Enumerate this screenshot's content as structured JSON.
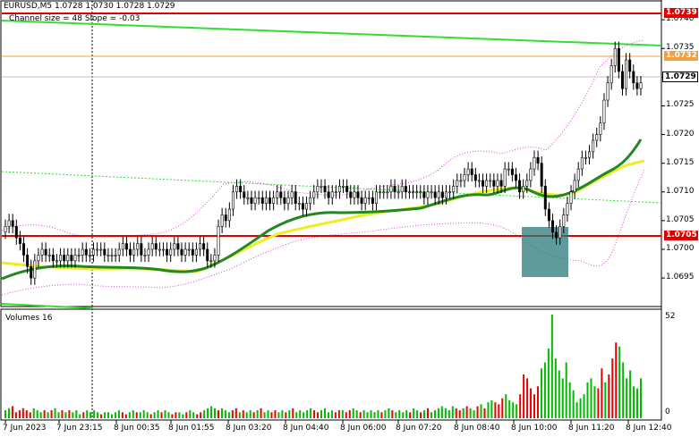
{
  "symbol_header": "EURUSD,M5  1.0728 1.0730 1.0728 1.0729",
  "indicator_label": "Channel size = 48 Slope = -0.03",
  "volume_label": "Volumes 16",
  "colors": {
    "resistance": "#e00000",
    "support": "#e00000",
    "orange_level": "#f0a040",
    "channel_line": "#33dd33",
    "ma_fast": "#228822",
    "ma_slow": "#eeee22",
    "bollinger": "#dd44dd",
    "volume_up": "#00bb00",
    "volume_down": "#ee0000",
    "box": "#2a7a7a",
    "current_tag": "#ffffff"
  },
  "price_axis": {
    "labels": [
      "1.0740",
      "1.0735",
      "1.0730",
      "1.0725",
      "1.0720",
      "1.0715",
      "1.0710",
      "1.0705",
      "1.0700",
      "1.0695"
    ],
    "range": [
      1.06905,
      1.07422
    ]
  },
  "price_tags": {
    "resistance": "1.0739",
    "orange": "1.0732",
    "current": "1.0729",
    "support": "1.0705"
  },
  "volume_axis": {
    "labels": [
      "52",
      "0"
    ],
    "range": [
      0,
      52
    ]
  },
  "time_axis": [
    "7 Jun 2023",
    "7 Jun 23:15",
    "8 Jun 00:35",
    "8 Jun 01:55",
    "8 Jun 03:20",
    "8 Jun 04:40",
    "8 Jun 06:00",
    "8 Jun 07:20",
    "8 Jun 08:40",
    "8 Jun 10:00",
    "8 Jun 11:20",
    "8 Jun 12:40"
  ],
  "chart_data": {
    "type": "candlestick",
    "candles_close": [
      1.0704,
      1.0705,
      1.0704,
      1.0702,
      1.0701,
      1.0699,
      1.0697,
      1.0695,
      1.0698,
      1.0699,
      1.07,
      1.0699,
      1.0699,
      1.0698,
      1.0698,
      1.0699,
      1.0698,
      1.0699,
      1.0698,
      1.0699,
      1.0699,
      1.07,
      1.0699,
      1.0699,
      1.07,
      1.07,
      1.07,
      1.0699,
      1.0699,
      1.0699,
      1.0699,
      1.07,
      1.0701,
      1.07,
      1.0699,
      1.07,
      1.0701,
      1.0699,
      1.0699,
      1.07,
      1.0701,
      1.07,
      1.07,
      1.07,
      1.0699,
      1.07,
      1.0701,
      1.07,
      1.0699,
      1.07,
      1.07,
      1.0699,
      1.07,
      1.0701,
      1.07,
      1.0698,
      1.0698,
      1.0699,
      1.0704,
      1.0706,
      1.0705,
      1.0707,
      1.071,
      1.0711,
      1.071,
      1.0709,
      1.0709,
      1.0708,
      1.0709,
      1.0709,
      1.0708,
      1.0709,
      1.0708,
      1.0709,
      1.071,
      1.0709,
      1.0708,
      1.0709,
      1.071,
      1.0708,
      1.0708,
      1.0707,
      1.0708,
      1.0709,
      1.071,
      1.0711,
      1.0711,
      1.071,
      1.0709,
      1.071,
      1.071,
      1.0711,
      1.0711,
      1.071,
      1.0709,
      1.071,
      1.0709,
      1.0708,
      1.0709,
      1.0709,
      1.0708,
      1.071,
      1.071,
      1.071,
      1.071,
      1.0711,
      1.071,
      1.071,
      1.0711,
      1.071,
      1.071,
      1.071,
      1.071,
      1.071,
      1.0709,
      1.071,
      1.071,
      1.0709,
      1.071,
      1.0709,
      1.071,
      1.071,
      1.0711,
      1.0712,
      1.0712,
      1.0713,
      1.0714,
      1.0713,
      1.0712,
      1.0712,
      1.0711,
      1.0712,
      1.0712,
      1.0711,
      1.0712,
      1.0711,
      1.0714,
      1.0714,
      1.0713,
      1.0712,
      1.071,
      1.0711,
      1.0712,
      1.0714,
      1.0716,
      1.0715,
      1.0711,
      1.0707,
      1.0705,
      1.0703,
      1.0702,
      1.0704,
      1.0706,
      1.0708,
      1.071,
      1.0712,
      1.0714,
      1.0716,
      1.0716,
      1.0717,
      1.0719,
      1.072,
      1.0722,
      1.0726,
      1.0729,
      1.0732,
      1.0735,
      1.0731,
      1.0728,
      1.0733,
      1.0731,
      1.0729,
      1.0728,
      1.0729
    ],
    "volumes": [
      4,
      5,
      6,
      3,
      4,
      5,
      4,
      3,
      5,
      4,
      3,
      4,
      3,
      4,
      5,
      3,
      4,
      3,
      4,
      3,
      4,
      2,
      3,
      4,
      3,
      4,
      3,
      2,
      3,
      3,
      2,
      3,
      4,
      3,
      2,
      3,
      4,
      3,
      3,
      4,
      3,
      2,
      3,
      4,
      3,
      4,
      3,
      2,
      3,
      3,
      2,
      3,
      4,
      3,
      2,
      3,
      4,
      5,
      6,
      5,
      4,
      5,
      4,
      3,
      4,
      5,
      3,
      4,
      3,
      4,
      3,
      4,
      5,
      3,
      4,
      3,
      4,
      3,
      4,
      3,
      4,
      5,
      3,
      4,
      3,
      4,
      5,
      4,
      3,
      4,
      5,
      3,
      4,
      3,
      4,
      4,
      3,
      4,
      5,
      4,
      3,
      4,
      3,
      4,
      3,
      4,
      3,
      4,
      5,
      4,
      3,
      4,
      3,
      4,
      3,
      5,
      4,
      3,
      4,
      5,
      3,
      4,
      5,
      6,
      5,
      4,
      6,
      5,
      4,
      5,
      6,
      5,
      4,
      6,
      7,
      5,
      8,
      9,
      8,
      7,
      10,
      12,
      9,
      8,
      7,
      12,
      22,
      20,
      15,
      12,
      16,
      25,
      28,
      35,
      52,
      30,
      24,
      20,
      28,
      18,
      14,
      8,
      10,
      12,
      18,
      20,
      16,
      15,
      25,
      18,
      22,
      30,
      38,
      36,
      28,
      20,
      24,
      16,
      15,
      20
    ]
  }
}
